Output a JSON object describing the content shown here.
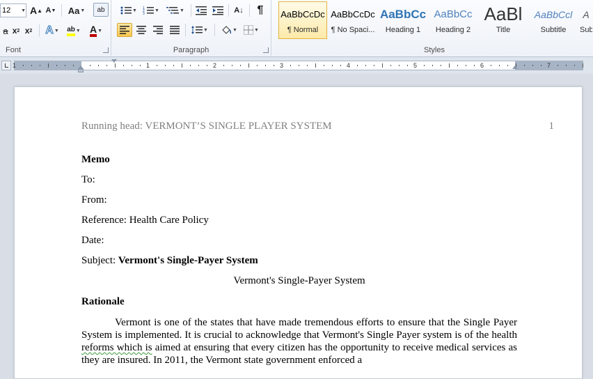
{
  "ribbon": {
    "font_group": {
      "label": "Font",
      "font_size": "12",
      "grow_glyph": "A",
      "shrink_glyph": "A",
      "case_glyph": "Aa",
      "clear_format_glyph": "ab",
      "strike_glyph": "a",
      "sub_glyph": "x",
      "sup_glyph": "x",
      "effects_glyph": "A",
      "highlight_glyph": "ab",
      "font_color_glyph": "A"
    },
    "paragraph_group": {
      "label": "Paragraph",
      "sort_glyph": "A↓",
      "pilcrow_glyph": "¶"
    },
    "styles_group": {
      "label": "Styles",
      "items": [
        {
          "sample": "AaBbCcDc",
          "name": "¶ Normal"
        },
        {
          "sample": "AaBbCcDc",
          "name": "¶ No Spaci..."
        },
        {
          "sample": "AaBbCc",
          "name": "Heading 1"
        },
        {
          "sample": "AaBbCc",
          "name": "Heading 2"
        },
        {
          "sample": "AaBl",
          "name": "Title"
        },
        {
          "sample": "AaBbCcl",
          "name": "Subtitle"
        },
        {
          "sample": "A",
          "name": "Subtle"
        }
      ]
    },
    "colors": {
      "accent_selected": "#f8c752",
      "heading": "#2e74b5",
      "highlight": "#ffff00",
      "font_color": "#c00000"
    }
  },
  "ruler": {
    "numbers": [
      "1",
      "1",
      "2",
      "3",
      "4",
      "5",
      "6",
      "7"
    ]
  },
  "document": {
    "header": {
      "running_head": "Running head: VERMONT’S SINGLE PLAYER SYSTEM",
      "page_number": "1"
    },
    "memo_title": "Memo",
    "to_label": "To:",
    "from_label": "From:",
    "reference_label": "Reference: ",
    "reference_value": "Health Care Policy",
    "date_label": "Date:",
    "subject_label": "Subject: ",
    "subject_value": "Vermont's Single-Payer System",
    "centered_title": "Vermont's Single-Payer System",
    "section_heading": "Rationale",
    "paragraph": {
      "part1": "Vermont is one of the states that have made tremendous efforts to ensure that the Single Payer System is implemented. It is crucial to acknowledge that Vermont's Single Payer system is of the health ",
      "flagged": "reforms which is",
      "part2": " aimed at ensuring that every citizen has the opportunity to receive medical services as they are insured. In 2011, the Vermont state government enforced a"
    }
  }
}
